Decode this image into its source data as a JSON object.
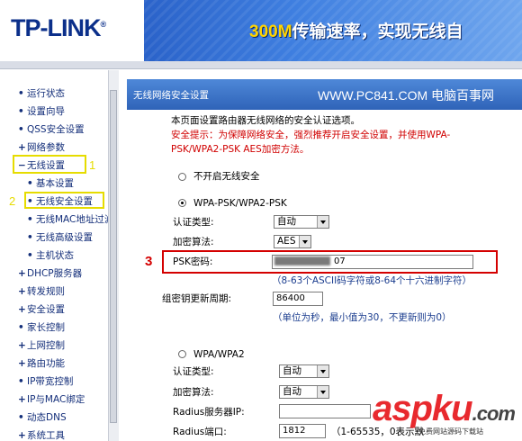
{
  "header": {
    "logo": "TP-LINK",
    "logo_reg": "®",
    "banner_speed": "300M",
    "banner_text": "传输速率，实现无线自"
  },
  "sidebar": {
    "items": [
      {
        "bullet": "•",
        "label": "运行状态"
      },
      {
        "bullet": "•",
        "label": "设置向导"
      },
      {
        "bullet": "•",
        "label": "QSS安全设置"
      },
      {
        "bullet": "+",
        "label": "网络参数"
      },
      {
        "bullet": "−",
        "label": "无线设置"
      },
      {
        "bullet": "•",
        "label": "基本设置"
      },
      {
        "bullet": "•",
        "label": "无线安全设置"
      },
      {
        "bullet": "•",
        "label": "无线MAC地址过滤"
      },
      {
        "bullet": "•",
        "label": "无线高级设置"
      },
      {
        "bullet": "•",
        "label": "主机状态"
      },
      {
        "bullet": "+",
        "label": "DHCP服务器"
      },
      {
        "bullet": "+",
        "label": "转发规则"
      },
      {
        "bullet": "+",
        "label": "安全设置"
      },
      {
        "bullet": "•",
        "label": "家长控制"
      },
      {
        "bullet": "+",
        "label": "上网控制"
      },
      {
        "bullet": "+",
        "label": "路由功能"
      },
      {
        "bullet": "•",
        "label": "IP带宽控制"
      },
      {
        "bullet": "+",
        "label": "IP与MAC绑定"
      },
      {
        "bullet": "•",
        "label": "动态DNS"
      },
      {
        "bullet": "+",
        "label": "系统工具"
      }
    ]
  },
  "panel": {
    "title": "无线网络安全设置",
    "watermark": "WWW.PC841.COM 电脑百事网",
    "intro": "本页面设置路由器无线网络的安全认证选项。",
    "tip_line1": "安全提示：为保障网络安全，强烈推荐开启安全设置，并使用WPA-",
    "tip_line2": "PSK/WPA2-PSK AES加密方法。",
    "option_none": "不开启无线安全",
    "option_wpa_psk": "WPA-PSK/WPA2-PSK",
    "auth_type_label": "认证类型:",
    "auth_type_value": "自动",
    "encrypt_label": "加密算法:",
    "encrypt_value": "AES",
    "psk_label": "PSK密码:",
    "psk_value": "07",
    "psk_hint": "（8-63个ASCII码字符或8-64个十六进制字符）",
    "group_key_label": "组密钥更新周期:",
    "group_key_value": "86400",
    "group_key_hint": "（单位为秒，最小值为30，不更新则为0）",
    "option_wpa": "WPA/WPA2",
    "auth_type2_label": "认证类型:",
    "auth_type2_value": "自动",
    "encrypt2_label": "加密算法:",
    "encrypt2_value": "自动",
    "radius_ip_label": "Radius服务器IP:",
    "radius_ip_value": "",
    "radius_port_label": "Radius端口:",
    "radius_port_value": "1812",
    "radius_port_hint": "（1-65535，0表示默"
  },
  "annotations": {
    "n1": "1",
    "n2": "2",
    "n3": "3"
  },
  "watermark_bottom": {
    "brand": "aspku",
    "suffix": ".com",
    "sub": "免费网站源码下载站"
  },
  "colors": {
    "annotation_yellow": "#e6dc00",
    "annotation_red": "#d40000",
    "tip_red": "#d00000"
  }
}
